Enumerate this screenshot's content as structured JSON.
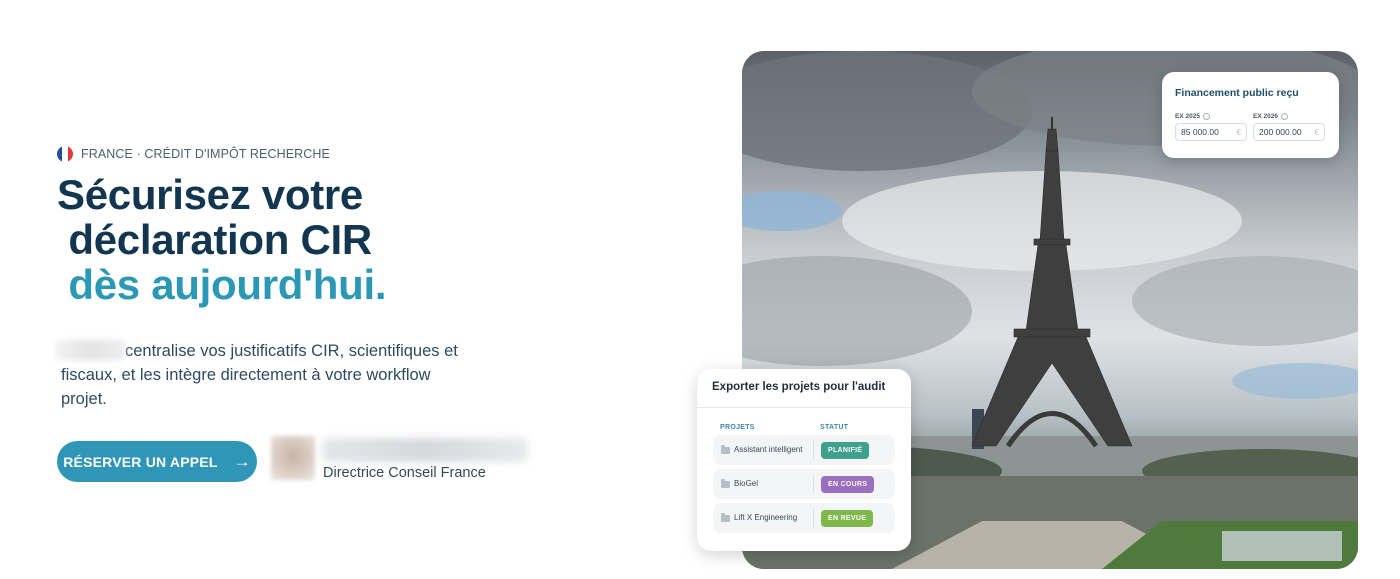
{
  "hero": {
    "eyebrow": "FRANCE · CRÉDIT D'IMPÔT RECHERCHE",
    "headline_line1": "Sécurisez votre",
    "headline_line2": " déclaration CIR",
    "headline_line3": " dès aujourd'hui.",
    "lead_text": "centralise vos justificatifs CIR, scientifiques et fiscaux, et les intègre directement à votre workflow projet.",
    "cta_label": "RÉSERVER UN APPEL",
    "cta_icon": "arrow-right-icon",
    "contact_role": "Directrice Conseil France"
  },
  "finance_card": {
    "title": "Financement public reçu",
    "fields": [
      {
        "label": "EX 2025",
        "value": "85 000.00",
        "currency": "€"
      },
      {
        "label": "EX 2026",
        "value": "200 000.00",
        "currency": "€"
      }
    ]
  },
  "export_card": {
    "title": "Exporter les projets pour l'audit",
    "col_projects": "PROJETS",
    "col_status": "STATUT",
    "rows": [
      {
        "name": "Assistant intelligent",
        "status": "PLANIFIÉ",
        "color": "#3ea18c"
      },
      {
        "name": "BioGel",
        "status": "EN COURS",
        "color": "#9b6fc0"
      },
      {
        "name": "Lift X Engineering",
        "status": "EN REVUE",
        "color": "#7fb84a"
      }
    ]
  },
  "colors": {
    "primary": "#2f96b7",
    "headline": "#133650",
    "accent_text": "#2b98b6"
  }
}
